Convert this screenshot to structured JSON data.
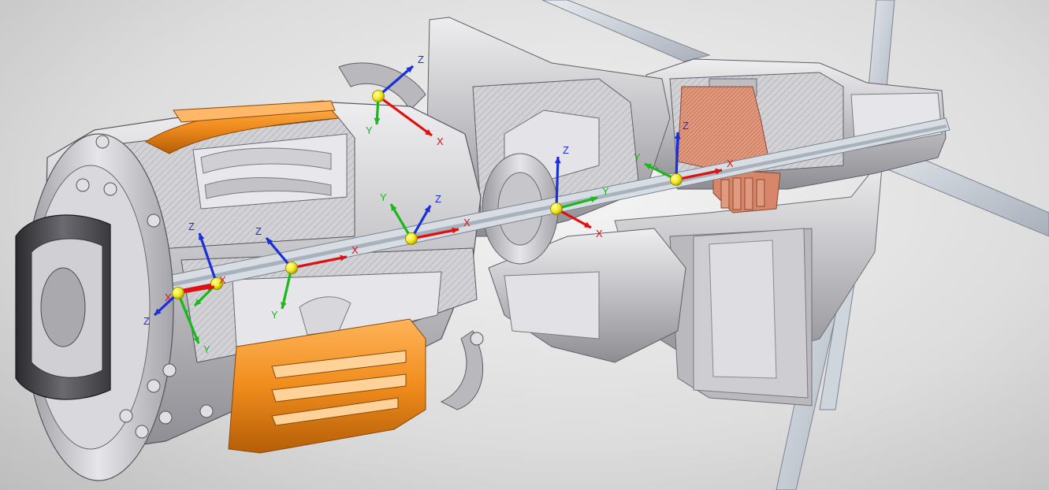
{
  "viewport": {
    "background_top": "#f4f4f4",
    "background_bottom": "#bdbdbd"
  },
  "colors": {
    "casing": "#c9c9cc",
    "casing_dark": "#8e8e94",
    "section_cut": "#d8d8dc",
    "hatch": "#a8a8ae",
    "orange": "#f08c1c",
    "copper": "#d8866a",
    "stand": "#c6ccd4",
    "x_axis": "#e01010",
    "y_axis": "#19b81b",
    "z_axis": "#1a2fd6",
    "origin": "#f2e81a"
  },
  "axis_labels": {
    "x": "X",
    "y": "Y",
    "z": "Z"
  },
  "frames": [
    {
      "id": "frame-1"
    },
    {
      "id": "frame-2"
    },
    {
      "id": "frame-3"
    },
    {
      "id": "frame-4"
    },
    {
      "id": "frame-5"
    },
    {
      "id": "frame-6"
    },
    {
      "id": "frame-7"
    },
    {
      "id": "frame-8"
    }
  ]
}
